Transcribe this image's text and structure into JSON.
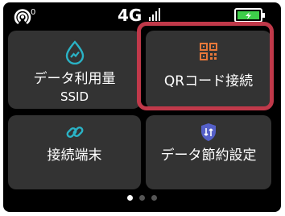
{
  "status_bar": {
    "wifi_count": "0",
    "network": "4G"
  },
  "tiles": [
    {
      "label": "データ利用量",
      "sublabel": "SSID",
      "icon": "data-usage-icon"
    },
    {
      "label": "QRコード接続",
      "icon": "qr-code-icon"
    },
    {
      "label": "接続端末",
      "icon": "link-icon"
    },
    {
      "label": "データ節約設定",
      "icon": "data-saver-shield-icon"
    }
  ],
  "colors": {
    "background": "#000000",
    "tile": "#333333",
    "highlight": "#c0394a",
    "accent_cyan": "#2ab3c6",
    "qr_orange": "#e8783a",
    "shield_blue": "#5560c8",
    "battery_green": "#3ecf4a"
  },
  "pager": {
    "total": 3,
    "current": 1
  }
}
